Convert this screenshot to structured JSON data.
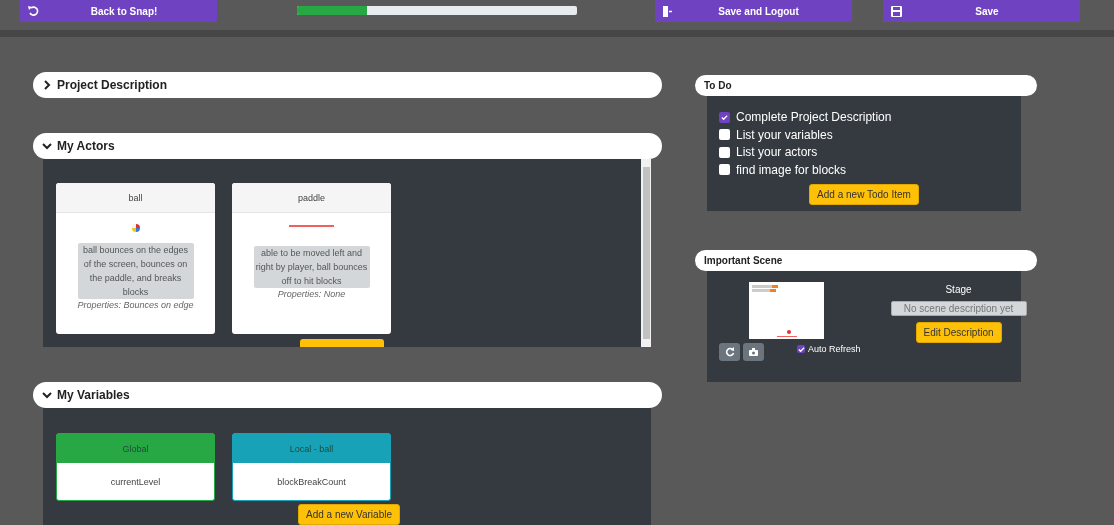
{
  "top_bar": {
    "back_button": {
      "label": "Back to Snap!"
    },
    "progress": {
      "level": 0.25
    },
    "logout_button": {
      "label": "Save and Logout"
    },
    "save_button": {
      "label": "Save"
    }
  },
  "sections": [
    {
      "title": "Project Description",
      "expanded": false
    },
    {
      "title": "My Actors",
      "expanded": true,
      "kind": "actors",
      "actors": [
        {
          "name": "ball",
          "kind": "ball",
          "description": "ball bounces on the edges of the screen, bounces on the paddle, and breaks blocks",
          "properties": "Properties: Bounces on edge"
        },
        {
          "name": "paddle",
          "kind": "paddle",
          "description": "able to be moved left and right by player, ball bounces off to hit blocks",
          "properties": "Properties: None"
        }
      ]
    },
    {
      "title": "My Variables",
      "expanded": true,
      "kind": "variables",
      "variables": [
        {
          "scope": "Global",
          "color": "#28a745",
          "name": "currentLevel"
        },
        {
          "scope": "Local - ball",
          "color": "#17a2b8",
          "name": "blockBreakCount"
        }
      ],
      "add_button": "Add a new Variable"
    }
  ],
  "todo": {
    "title": "To Do",
    "items": [
      {
        "label": "Complete Project Description",
        "checked": true
      },
      {
        "label": "List your variables",
        "checked": false
      },
      {
        "label": "List your actors",
        "checked": false
      },
      {
        "label": "find image for blocks",
        "checked": false
      }
    ],
    "add_button": "Add a new Todo Item"
  },
  "scene": {
    "title": "Important Scene",
    "name": "Stage",
    "description_placeholder": "No scene description yet",
    "edit_button": "Edit Description",
    "auto_refresh": {
      "label": "Auto Refresh",
      "checked": true
    }
  }
}
